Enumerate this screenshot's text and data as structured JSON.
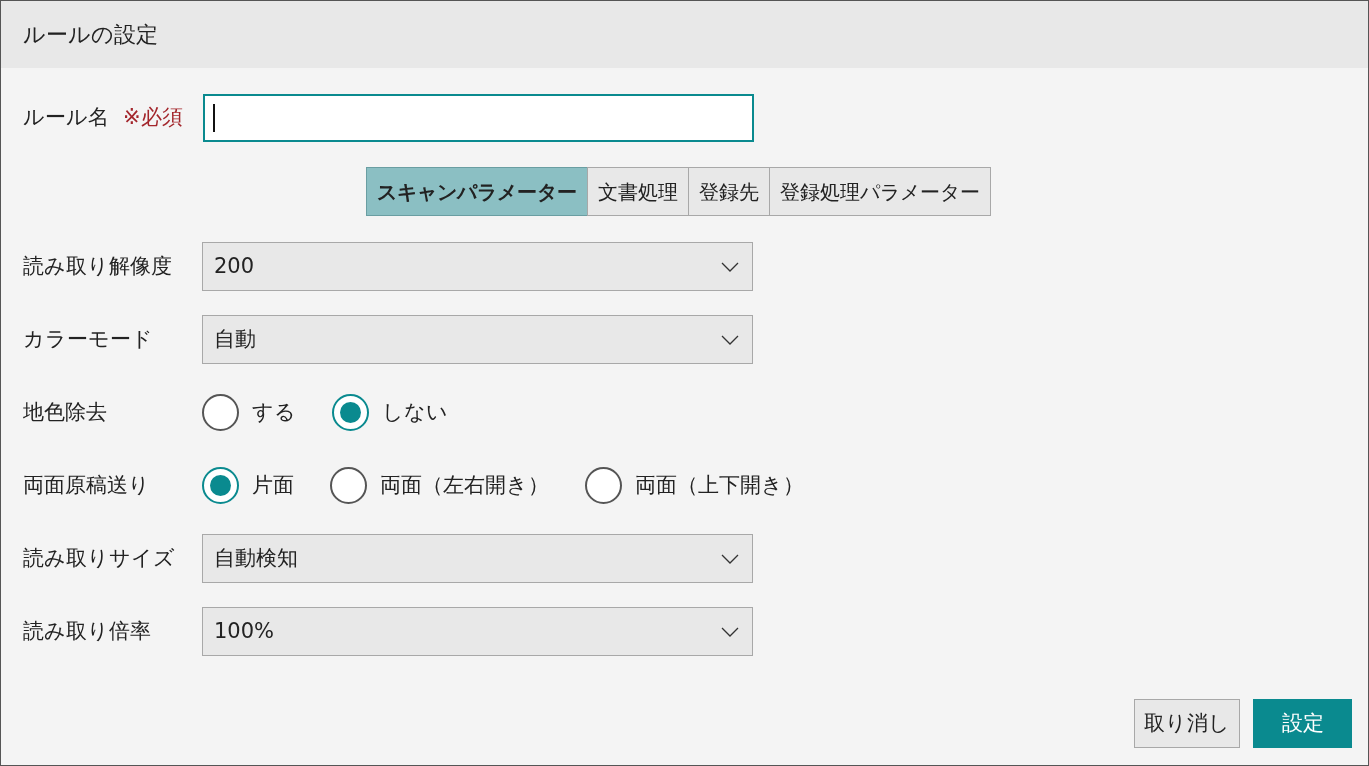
{
  "window": {
    "title": "ルールの設定"
  },
  "rule_name": {
    "label": "ルール名",
    "required": "※必須",
    "focused": true
  },
  "tabs": [
    {
      "label": "スキャンパラメーター",
      "selected": true
    },
    {
      "label": "文書処理",
      "selected": false
    },
    {
      "label": "登録先",
      "selected": false
    },
    {
      "label": "登録処理パラメーター",
      "selected": false
    }
  ],
  "fields": [
    {
      "kind": "select",
      "label": "読み取り解像度",
      "value": "200"
    },
    {
      "kind": "select",
      "label": "カラーモード",
      "value": "自動"
    },
    {
      "kind": "radio",
      "label": "地色除去",
      "options": [
        {
          "label": "する",
          "selected": false
        },
        {
          "label": "しない",
          "selected": true
        }
      ]
    },
    {
      "kind": "radio",
      "label": "両面原稿送り",
      "options": [
        {
          "label": "片面",
          "selected": true
        },
        {
          "label": "両面（左右開き）",
          "selected": false
        },
        {
          "label": "両面（上下開き）",
          "selected": false
        }
      ]
    },
    {
      "kind": "select",
      "label": "読み取りサイズ",
      "value": "自動検知"
    },
    {
      "kind": "select",
      "label": "読み取り倍率",
      "value": "100%"
    }
  ],
  "buttons": [
    {
      "label": "取り消し",
      "kind": "secondary"
    },
    {
      "label": "設定",
      "kind": "primary"
    }
  ]
}
